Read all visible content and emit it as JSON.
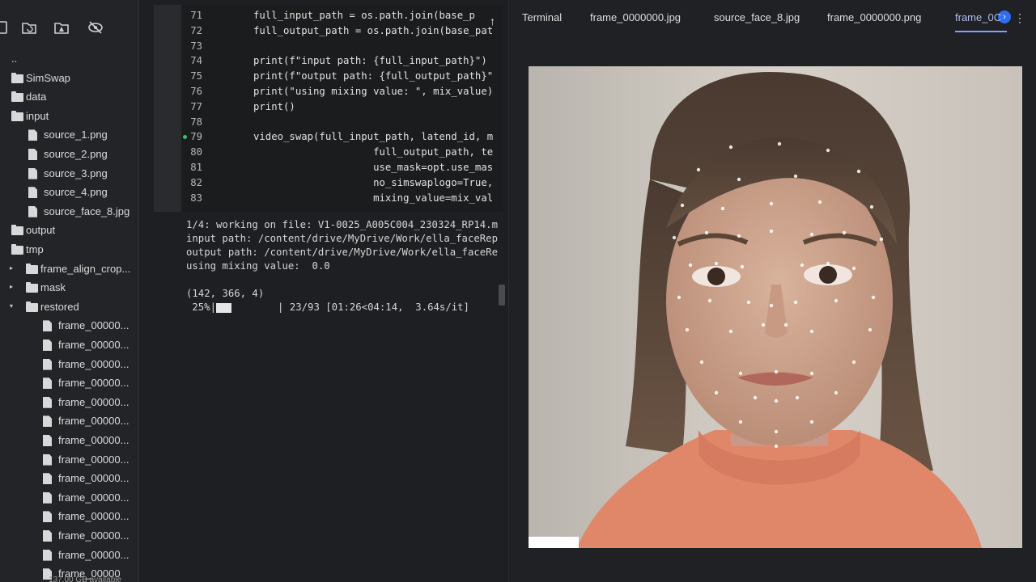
{
  "sidebar": {
    "toolbar": [
      {
        "name": "upload-icon"
      },
      {
        "name": "refresh-folder-icon"
      },
      {
        "name": "drive-icon"
      },
      {
        "name": "hide-icon"
      }
    ],
    "tree": [
      {
        "label": "..",
        "type": "parent",
        "depth": 0,
        "arrow": ""
      },
      {
        "label": "SimSwap",
        "type": "folder",
        "depth": 0,
        "arrow": ""
      },
      {
        "label": "data",
        "type": "folder",
        "depth": 0,
        "arrow": ""
      },
      {
        "label": "input",
        "type": "folder",
        "depth": 1,
        "arrow": ""
      },
      {
        "label": "source_1.png",
        "type": "file",
        "depth": 2,
        "arrow": ""
      },
      {
        "label": "source_2.png",
        "type": "file",
        "depth": 2,
        "arrow": ""
      },
      {
        "label": "source_3.png",
        "type": "file",
        "depth": 2,
        "arrow": ""
      },
      {
        "label": "source_4.png",
        "type": "file",
        "depth": 2,
        "arrow": ""
      },
      {
        "label": "source_face_8.jpg",
        "type": "file",
        "depth": 2,
        "arrow": ""
      },
      {
        "label": "output",
        "type": "folder",
        "depth": 1,
        "arrow": ""
      },
      {
        "label": "tmp",
        "type": "folder",
        "depth": 1,
        "arrow": ""
      },
      {
        "label": "frame_align_crop...",
        "type": "folder",
        "depth": 2,
        "arrow": "▸"
      },
      {
        "label": "mask",
        "type": "folder",
        "depth": 2,
        "arrow": "▸"
      },
      {
        "label": "restored",
        "type": "folder",
        "depth": 2,
        "arrow": "▾"
      },
      {
        "label": "frame_00000...",
        "type": "file",
        "depth": 3,
        "arrow": ""
      },
      {
        "label": "frame_00000...",
        "type": "file",
        "depth": 3,
        "arrow": ""
      },
      {
        "label": "frame_00000...",
        "type": "file",
        "depth": 3,
        "arrow": ""
      },
      {
        "label": "frame_00000...",
        "type": "file",
        "depth": 3,
        "arrow": ""
      },
      {
        "label": "frame_00000...",
        "type": "file",
        "depth": 3,
        "arrow": ""
      },
      {
        "label": "frame_00000...",
        "type": "file",
        "depth": 3,
        "arrow": ""
      },
      {
        "label": "frame_00000...",
        "type": "file",
        "depth": 3,
        "arrow": ""
      },
      {
        "label": "frame_00000...",
        "type": "file",
        "depth": 3,
        "arrow": ""
      },
      {
        "label": "frame_00000...",
        "type": "file",
        "depth": 3,
        "arrow": ""
      },
      {
        "label": "frame_00000...",
        "type": "file",
        "depth": 3,
        "arrow": ""
      },
      {
        "label": "frame_00000...",
        "type": "file",
        "depth": 3,
        "arrow": ""
      },
      {
        "label": "frame_00000...",
        "type": "file",
        "depth": 3,
        "arrow": ""
      },
      {
        "label": "frame_00000...",
        "type": "file",
        "depth": 3,
        "arrow": ""
      },
      {
        "label": "frame_00000",
        "type": "file",
        "depth": 3,
        "arrow": ""
      }
    ],
    "footer": "137.00 GB available"
  },
  "code": {
    "lines": [
      {
        "num": "71",
        "text": "full_input_path = os.path.join(base_p"
      },
      {
        "num": "72",
        "text": "full_output_path = os.path.join(base_pat"
      },
      {
        "num": "73",
        "text": ""
      },
      {
        "num": "74",
        "text": "print(f\"input path: {full_input_path}\")"
      },
      {
        "num": "75",
        "text": "print(f\"output path: {full_output_path}\""
      },
      {
        "num": "76",
        "text": "print(\"using mixing value: \", mix_value)"
      },
      {
        "num": "77",
        "text": "print()"
      },
      {
        "num": "78",
        "text": ""
      },
      {
        "num": "79",
        "text": "video_swap(full_input_path, latend_id, m"
      },
      {
        "num": "80",
        "text": "                    full_output_path, te"
      },
      {
        "num": "81",
        "text": "                    use_mask=opt.use_mas"
      },
      {
        "num": "82",
        "text": "                    no_simswaplogo=True,"
      },
      {
        "num": "83",
        "text": "                    mixing_value=mix_val"
      }
    ],
    "active_line": "79",
    "scroll_up": "↑"
  },
  "output": {
    "lines": [
      "1/4: working on file: V1-0025_A005C004_230324_RP14.m",
      "input path: /content/drive/MyDrive/Work/ella_faceRep",
      "output path: /content/drive/MyDrive/Work/ella_faceRe",
      "using mixing value:  0.0",
      "",
      "(142, 366, 4)"
    ],
    "progress_prefix": " 25%|",
    "progress_suffix": "| 23/93 [01:26<04:14,  3.64s/it]",
    "progress_fraction": 0.25
  },
  "tabs": [
    {
      "label": "Terminal",
      "active": false
    },
    {
      "label": "frame_0000000.jpg",
      "active": false
    },
    {
      "label": "source_face_8.jpg",
      "active": false
    },
    {
      "label": "frame_0000000.png",
      "active": false
    },
    {
      "label": "frame_0C",
      "active": true
    }
  ],
  "tab_nav": {
    "next": "›",
    "more": "⋮"
  },
  "image_view": {
    "subject": "photo of a child's face with facial landmark dots"
  }
}
